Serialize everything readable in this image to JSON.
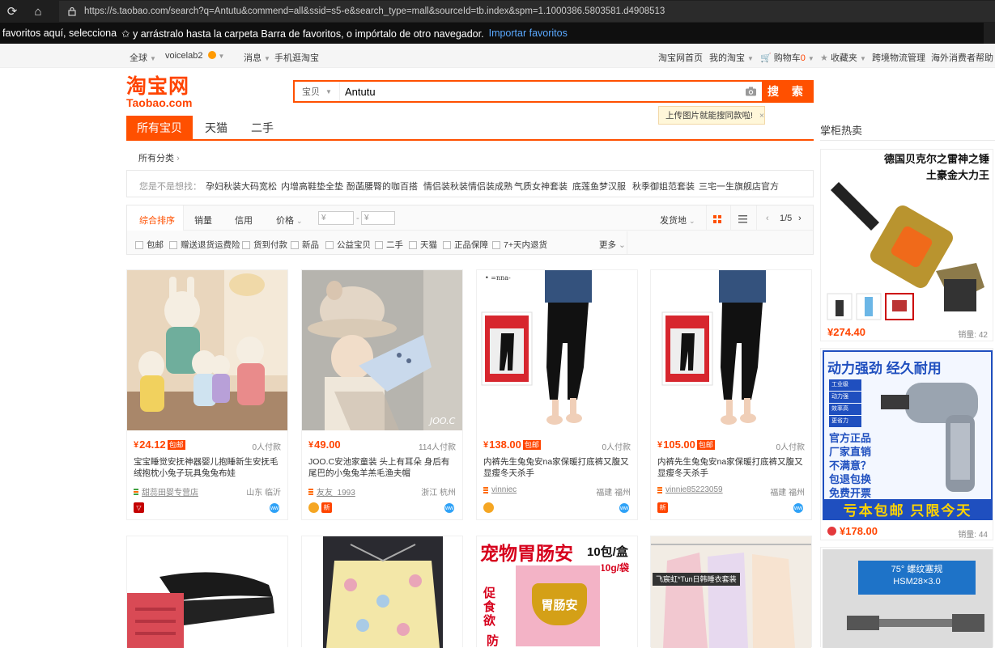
{
  "browser": {
    "url": "https://s.taobao.com/search?q=Antutu&commend=all&ssid=s5-e&search_type=mall&sourceId=tb.index&spm=1.1000386.5803581.d4908513",
    "fav_text_a": "favoritos aquí, selecciona",
    "fav_text_b": "✩ y arrástralo hasta la carpeta Barra de favoritos, o impórtalo de otro navegador.",
    "fav_import": "Importar favoritos"
  },
  "sitenav": {
    "global": "全球",
    "user": "voicelab2",
    "messages": "消息",
    "mobile": "手机逛淘宝",
    "home": "淘宝网首页",
    "my_taobao": "我的淘宝",
    "cart": "购物车",
    "cart_count": "0",
    "favorites": "收藏夹",
    "logistics": "跨境物流管理",
    "help": "海外消费者帮助"
  },
  "logo": {
    "cn": "淘宝网",
    "en": "Taobao.com"
  },
  "search": {
    "category": "宝贝",
    "query": "Antutu",
    "button": "搜 索",
    "tip": "上传图片就能搜同款啦!"
  },
  "tabs": [
    "所有宝贝",
    "天猫",
    "二手"
  ],
  "all_categories": "所有分类",
  "suggest": {
    "label": "您是不是想找：",
    "items": [
      "孕妇秋装大码宽松",
      "内增高鞋垫全垫",
      "酚菡腰臀的咖百搭",
      "情侣装秋装情侣装成熟",
      "气质女神套装",
      "底莲鱼梦汉服",
      "秋季御姐范套装",
      "三宅一生旗舰店官方"
    ]
  },
  "sortbar": {
    "sorts": [
      "综合排序",
      "销量",
      "信用",
      "价格"
    ],
    "price_min": "¥",
    "price_max": "¥",
    "ship_from": "发货地",
    "page": "1/5",
    "filters": [
      "包邮",
      "赠送退货运费险",
      "货到付款",
      "新品",
      "公益宝贝",
      "二手",
      "天猫",
      "正品保障",
      "7+天内退货"
    ],
    "more": "更多"
  },
  "products": [
    {
      "price": "24.12",
      "byou": "包邮",
      "sold": "0人付款",
      "title": "宝宝睡觉安抚神器婴儿抱睡新生安抚毛绒抱枕小兔子玩具兔兔布娃",
      "shop": "甜蕊田婴专营店",
      "loc": "山东 临沂"
    },
    {
      "price": "49.00",
      "byou": "",
      "sold": "114人付款",
      "title": "JOO.C安池家童装 头上有耳朵 身后有尾巴的小兔兔羊羔毛渔夫帽",
      "shop": "友友_1993",
      "loc": "浙江 杭州"
    },
    {
      "price": "138.00",
      "byou": "包邮",
      "sold": "0人付款",
      "title": "内裤先生兔兔安na家保暖打底裤又腹又显瘦冬天杀手",
      "shop": "vinniec",
      "loc": "福建 福州"
    },
    {
      "price": "105.00",
      "byou": "包邮",
      "sold": "0人付款",
      "title": "内裤先生兔兔安na家保暖打底裤又腹又显瘦冬天杀手",
      "shop": "vinnie85223059",
      "loc": "福建 福州"
    }
  ],
  "badges": {
    "new": "新"
  },
  "row2": {
    "pet_title": "宠物胃肠安",
    "pet_pack": "10包/盒",
    "pet_bag": "10g/袋",
    "pet_box": "胃肠安",
    "pet_side": "促食欲",
    "pet_side2": "防",
    "tooltip": "飞宸虹*Tun日韩睡衣套装"
  },
  "right": {
    "header": "掌柜热卖",
    "ad1_line1": "德国贝克尔之雷神之锤",
    "ad1_line2": "土豪金大力王",
    "ad1_price": "274.40",
    "ad1_sold": "销量: 42",
    "ad2_title": "动力强劲 经久耐用",
    "ad2_bullets": [
      "工业级",
      "动力强",
      "效率高",
      "更省力"
    ],
    "ad2_lines": [
      "官方正品",
      "厂家直销",
      "不满意？",
      "包退包换",
      "免费开票"
    ],
    "ad2_banner": "亏本包邮 只限今天",
    "ad2_price": "178.00",
    "ad2_sold": "销量: 44",
    "ad3_label1": "75°  螺纹塞规",
    "ad3_label2": "HSM28×3.0"
  },
  "colors": {
    "accent": "#ff5000",
    "price": "#ff4400"
  }
}
